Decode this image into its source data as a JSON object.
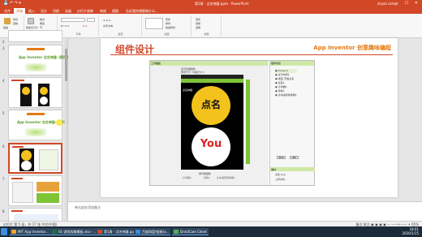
{
  "window": {
    "title": "第1周 - 点名神器.pptx - PowerPoint",
    "user": "zhyan zshop",
    "controls": "— ☐ ✕",
    "qat": "💾 ↶ ↷ ▾"
  },
  "ribbon_tabs": [
    "文件",
    "开始",
    "插入",
    "设计",
    "切换",
    "动画",
    "幻灯片放映",
    "审阅",
    "视图",
    "告诉我你想要做什么..."
  ],
  "ribbon_groups": [
    {
      "label": "剪贴板",
      "buttons": [
        "粘贴",
        "剪切",
        "复制"
      ]
    },
    {
      "label": "幻灯片",
      "buttons": [
        "新建幻灯片",
        "版式",
        "重置",
        "节"
      ]
    },
    {
      "label": "字体",
      "buttons": [
        "B I U S",
        "A A"
      ]
    },
    {
      "label": "段落",
      "buttons": [
        "≡ ≡ ≡",
        "文字方向"
      ]
    },
    {
      "label": "绘图",
      "buttons": [
        "形状",
        "排列",
        "快速样式"
      ]
    },
    {
      "label": "编辑",
      "buttons": [
        "查找",
        "替换",
        "选择"
      ]
    }
  ],
  "thumbnails": [
    {
      "num": "2",
      "caption": ""
    },
    {
      "num": "3",
      "caption": "App Inventor 点名神器--案例解决"
    },
    {
      "num": "4",
      "caption": ""
    },
    {
      "num": "5",
      "caption": "App Inventor 点名神器--组件设计"
    },
    {
      "num": "6",
      "caption": ""
    },
    {
      "num": "7",
      "caption": ""
    },
    {
      "num": "8",
      "caption": ""
    }
  ],
  "slide": {
    "title": "组件设计",
    "brand": "App Inventor 创意趣味编程",
    "shot": {
      "left_header": "工作面板",
      "checkbox_label": "显示隐藏组件",
      "screen_size": "预览尺寸: 平板尺寸 ▾",
      "app_bar": "点名神器",
      "circle1_text": "点名",
      "circle2_text": "You",
      "non_visible_label": "非可视组件",
      "non_visible_items": [
        "计时器1",
        "音效1",
        "文本语音转换器1"
      ],
      "right_header": "组件列表",
      "tree": [
        "▣ Screen1",
        "  ▣ 水平布局1",
        "    ▣ 按钮_开始点名",
        "  ▣ 标签1",
        "  ▣ 计时器1",
        "  ▣ 音效1",
        "  ▣ 文本语音转换器1"
      ],
      "rename_btn": "重命名",
      "delete_btn": "删除",
      "media_header": "素材",
      "media_items": [
        "点名.png",
        "上传文件..."
      ]
    }
  },
  "notes_placeholder": "单击此处添加备注",
  "statusbar": {
    "left": "幻灯片 第 5 张，共 17 张    中文(中国)",
    "right": "备注  批注    ▣ ▣ ▣ ▣    − ——+—— +  65%"
  },
  "taskbar": {
    "items": [
      {
        "label": "MIT App Inventor...",
        "color": "#f4a22c"
      },
      {
        "label": "01-游戏拆解模板.xlsx - ...",
        "color": "#1e7145"
      },
      {
        "label": "第1周 - 点名神器.pp...",
        "color": "#d24726"
      },
      {
        "label": "百度网盘(链接)a...",
        "color": "#3a8de0"
      },
      {
        "label": "DroidCam Client",
        "color": "#59b04b"
      }
    ],
    "time": "18:01",
    "date": "2020/1/15"
  }
}
